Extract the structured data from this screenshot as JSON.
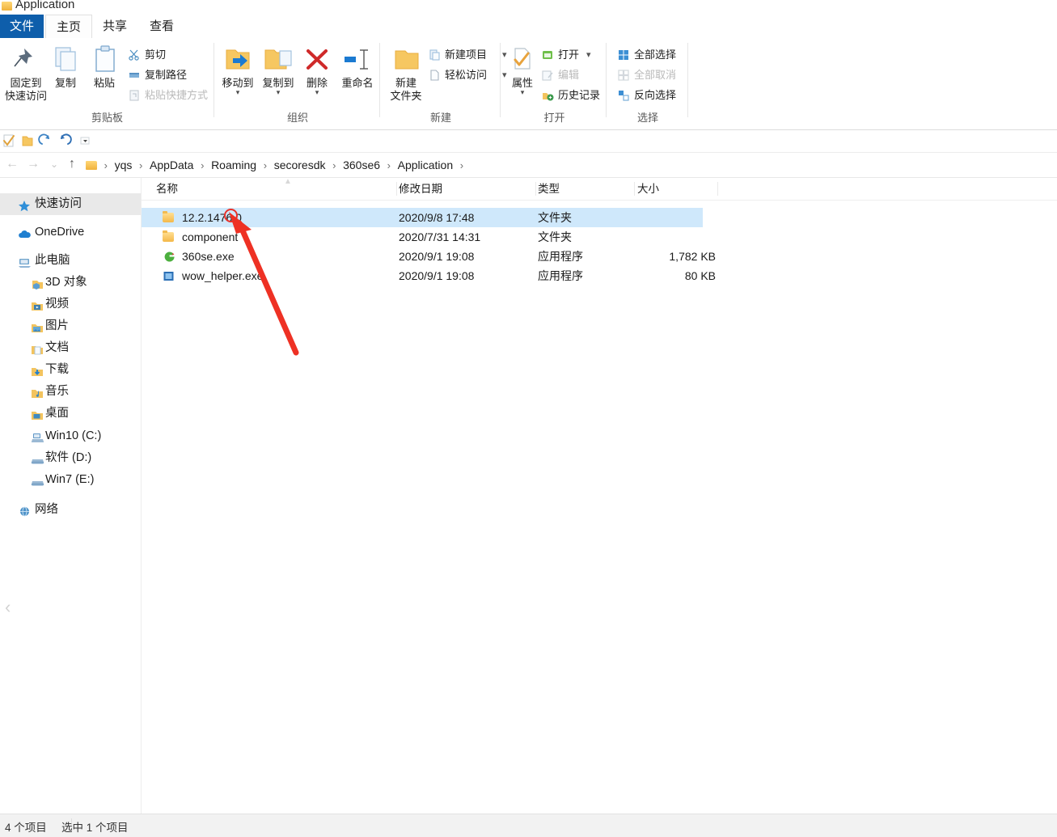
{
  "window": {
    "title": "Application",
    "folder_icon": "folder-icon"
  },
  "ribbon_tabs": [
    {
      "label": "文件",
      "name": "tab-file",
      "state": "file-menu"
    },
    {
      "label": "主页",
      "name": "tab-home",
      "state": "active"
    },
    {
      "label": "共享",
      "name": "tab-share",
      "state": "normal"
    },
    {
      "label": "查看",
      "name": "tab-view",
      "state": "normal"
    }
  ],
  "ribbon": {
    "groups": [
      {
        "name": "clipboard",
        "label": "剪贴板",
        "big_buttons": [
          {
            "label_line1": "固定到",
            "label_line2": "快速访问",
            "icon": "pin-icon",
            "disabled": false
          },
          {
            "label_line1": "复制",
            "label_line2": "",
            "icon": "copy-icon",
            "disabled": false
          },
          {
            "label_line1": "粘贴",
            "label_line2": "",
            "icon": "paste-icon",
            "disabled": false
          }
        ],
        "small_buttons": [
          {
            "label": "剪切",
            "icon": "scissors-icon",
            "disabled": false
          },
          {
            "label": "复制路径",
            "icon": "copy-path-icon",
            "disabled": false
          },
          {
            "label": "粘贴快捷方式",
            "icon": "paste-shortcut-icon",
            "disabled": true
          }
        ]
      },
      {
        "name": "organize",
        "label": "组织",
        "big_buttons": [
          {
            "label_line1": "移动到",
            "label_line2": "",
            "icon": "move-to-icon",
            "has_caret": true
          },
          {
            "label_line1": "复制到",
            "label_line2": "",
            "icon": "copy-to-icon",
            "has_caret": true
          },
          {
            "label_line1": "删除",
            "label_line2": "",
            "icon": "delete-x-icon",
            "has_caret": true
          },
          {
            "label_line1": "重命名",
            "label_line2": "",
            "icon": "rename-icon",
            "has_caret": false
          }
        ]
      },
      {
        "name": "new",
        "label": "新建",
        "big_buttons": [
          {
            "label_line1": "新建",
            "label_line2": "文件夹",
            "icon": "new-folder-icon"
          }
        ],
        "small_buttons": [
          {
            "label": "新建项目",
            "icon": "new-item-icon",
            "has_caret": true
          },
          {
            "label": "轻松访问",
            "icon": "easy-access-icon",
            "has_caret": true
          }
        ]
      },
      {
        "name": "open",
        "label": "打开",
        "big_buttons": [
          {
            "label_line1": "属性",
            "label_line2": "",
            "icon": "properties-icon",
            "has_caret": true
          }
        ],
        "small_buttons": [
          {
            "label": "打开",
            "icon": "open-icon",
            "has_caret": true,
            "disabled": false
          },
          {
            "label": "编辑",
            "icon": "edit-icon",
            "has_caret": false,
            "disabled": true
          },
          {
            "label": "历史记录",
            "icon": "history-icon",
            "has_caret": false,
            "disabled": false
          }
        ]
      },
      {
        "name": "select",
        "label": "选择",
        "small_buttons": [
          {
            "label": "全部选择",
            "icon": "select-all-icon",
            "disabled": false
          },
          {
            "label": "全部取消",
            "icon": "select-none-icon",
            "disabled": true
          },
          {
            "label": "反向选择",
            "icon": "invert-selection-icon",
            "disabled": false
          }
        ]
      }
    ]
  },
  "quick_access_toolbar": [
    {
      "name": "qat-properties",
      "icon": "properties-check-icon"
    },
    {
      "name": "qat-new-folder",
      "icon": "folder-icon"
    },
    {
      "name": "qat-redo",
      "icon": "redo-icon"
    },
    {
      "name": "qat-undo",
      "icon": "undo-icon"
    },
    {
      "name": "qat-customize",
      "icon": "chevron-down-icon"
    }
  ],
  "address_bar": {
    "back": "←",
    "forward": "→",
    "recent": "⌄",
    "up": "↑",
    "crumbs": [
      "yqs",
      "AppData",
      "Roaming",
      "secoresdk",
      "360se6",
      "Application"
    ],
    "separator": "›"
  },
  "sidebar": {
    "items": [
      {
        "label": "快速访问",
        "icon": "star-icon",
        "indent": 0,
        "selected": true
      },
      {
        "label": "OneDrive",
        "icon": "cloud-icon",
        "indent": 0,
        "selected": false
      },
      {
        "label": "此电脑",
        "icon": "this-pc-icon",
        "indent": 0,
        "selected": false
      },
      {
        "label": "3D 对象",
        "icon": "3d-objects-icon",
        "indent": 1,
        "selected": false
      },
      {
        "label": "视频",
        "icon": "videos-icon",
        "indent": 1,
        "selected": false
      },
      {
        "label": "图片",
        "icon": "pictures-icon",
        "indent": 1,
        "selected": false
      },
      {
        "label": "文档",
        "icon": "documents-icon",
        "indent": 1,
        "selected": false
      },
      {
        "label": "下载",
        "icon": "downloads-icon",
        "indent": 1,
        "selected": false
      },
      {
        "label": "音乐",
        "icon": "music-icon",
        "indent": 1,
        "selected": false
      },
      {
        "label": "桌面",
        "icon": "desktop-icon",
        "indent": 1,
        "selected": false
      },
      {
        "label": "Win10 (C:)",
        "icon": "system-drive-icon",
        "indent": 1,
        "selected": false
      },
      {
        "label": "软件 (D:)",
        "icon": "drive-icon",
        "indent": 1,
        "selected": false
      },
      {
        "label": "Win7 (E:)",
        "icon": "drive-icon",
        "indent": 1,
        "selected": false
      },
      {
        "label": "网络",
        "icon": "network-icon",
        "indent": 0,
        "selected": false
      }
    ]
  },
  "file_list": {
    "columns": [
      {
        "label": "名称",
        "sorted": true,
        "sort_dir": "asc"
      },
      {
        "label": "修改日期",
        "sorted": false
      },
      {
        "label": "类型",
        "sorted": false
      },
      {
        "label": "大小",
        "sorted": false
      }
    ],
    "rows": [
      {
        "name": "12.2.1476.0",
        "date": "2020/9/8 17:48",
        "type": "文件夹",
        "size": "",
        "icon": "folder-icon",
        "selected": true
      },
      {
        "name": "component",
        "date": "2020/7/31 14:31",
        "type": "文件夹",
        "size": "",
        "icon": "folder-icon",
        "selected": false
      },
      {
        "name": "360se.exe",
        "date": "2020/9/1 19:08",
        "type": "应用程序",
        "size": "1,782 KB",
        "icon": "360se-icon",
        "selected": false
      },
      {
        "name": "wow_helper.exe",
        "date": "2020/9/1 19:08",
        "type": "应用程序",
        "size": "80 KB",
        "icon": "exe-icon",
        "selected": false
      }
    ]
  },
  "status_bar": {
    "item_count": "4 个项目",
    "selection": "选中 1 个项目"
  },
  "annotation": {
    "arrow_color": "#ee3124",
    "cursor_marker": "circle-cursor"
  },
  "colors": {
    "tab_file_blue": "#0e5eab",
    "selection_blue": "#cfe8fb",
    "accent_red": "#ee3124"
  }
}
